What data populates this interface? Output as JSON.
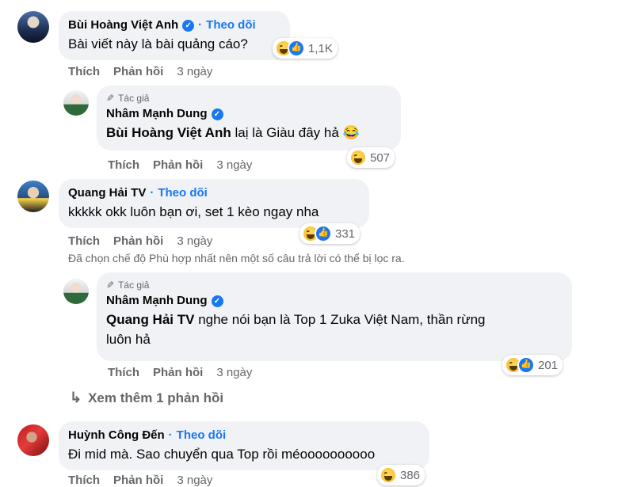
{
  "comments": [
    {
      "name": "Bùi Hoàng Việt Anh",
      "verified": true,
      "follow": "Theo dõi",
      "text": "Bài viết này là bài quảng cáo?",
      "reaction_count": "1,1K",
      "reactions": [
        "haha-icon",
        "like-icon"
      ],
      "actions": {
        "like": "Thích",
        "reply": "Phản hồi",
        "time": "3 ngày"
      }
    },
    {
      "author_tag": "Tác giả",
      "name": "Nhâm Mạnh Dung",
      "verified": true,
      "mention": "Bùi Hoàng Việt Anh",
      "text": " laị là Giàu đây hả 😂",
      "reaction_count": "507",
      "reactions": [
        "haha-icon"
      ],
      "actions": {
        "like": "Thích",
        "reply": "Phản hồi",
        "time": "3 ngày"
      }
    },
    {
      "name": "Quang Hải TV",
      "follow": "Theo dõi",
      "text": "kkkkk okk luôn bạn ơi, set 1 kèo ngay nha",
      "reaction_count": "331",
      "reactions": [
        "haha-icon",
        "like-icon"
      ],
      "actions": {
        "like": "Thích",
        "reply": "Phản hồi",
        "time": "3 ngày"
      }
    },
    {
      "author_tag": "Tác giả",
      "name": "Nhâm Mạnh Dung",
      "verified": true,
      "mention": "Quang Hải TV",
      "text": " nghe nói bạn là Top 1 Zuka Việt Nam, thần rừng",
      "text_line2": "luôn hả",
      "reaction_count": "201",
      "reactions": [
        "haha-icon",
        "like-icon"
      ],
      "actions": {
        "like": "Thích",
        "reply": "Phản hồi",
        "time": "3 ngày"
      }
    },
    {
      "name": "Huỳnh Công Đến",
      "follow": "Theo dõi",
      "text": "Đi mid mà. Sao chuyển qua Top rồi méoooooooooo",
      "reaction_count": "386",
      "reactions": [
        "haha-icon"
      ],
      "actions": {
        "like": "Thích",
        "reply": "Phản hồi",
        "time": "3 ngày"
      }
    }
  ],
  "filter_notice": "Đã chọn chế độ Phù hợp nhất nên một số câu trả lời có thể bị lọc ra.",
  "more_replies": "Xem thêm 1 phản hồi",
  "colors": {
    "accent": "#1877f2",
    "bubble": "#f0f2f5",
    "muted": "#65676b"
  }
}
